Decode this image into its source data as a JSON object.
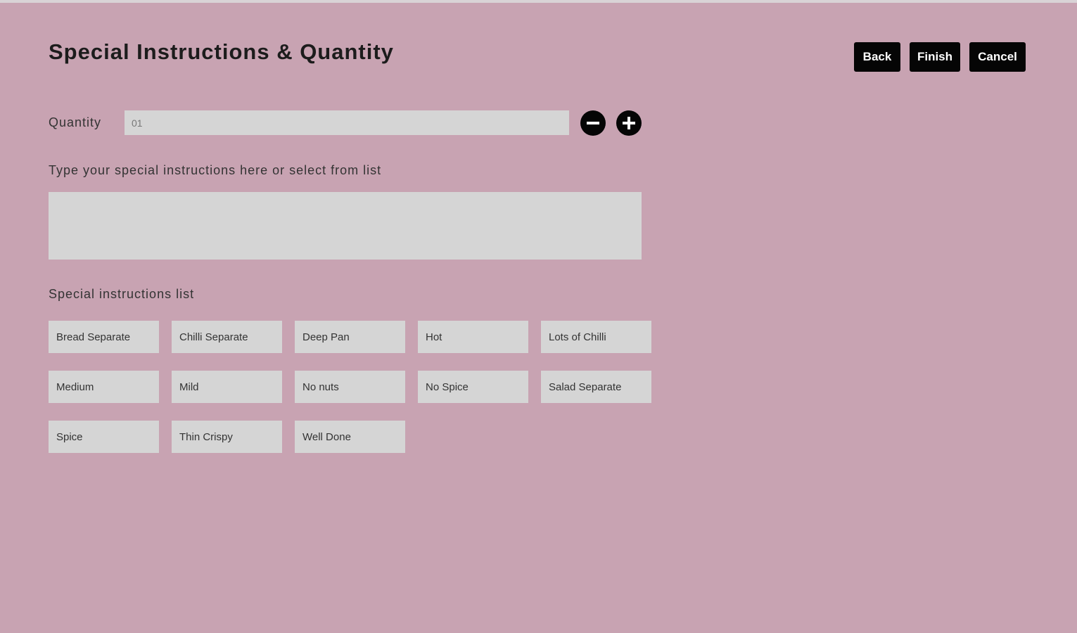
{
  "page": {
    "title": "Special Instructions & Quantity",
    "background_color": "#c8a3b2"
  },
  "actions": {
    "back_label": "Back",
    "finish_label": "Finish",
    "cancel_label": "Cancel"
  },
  "quantity": {
    "label": "Quantity",
    "value": "01",
    "minus_icon": "minus-circle-icon",
    "plus_icon": "plus-circle-icon"
  },
  "instructions": {
    "label": "Type your special instructions here or select from list",
    "value": ""
  },
  "instruction_list": {
    "label": "Special instructions list",
    "items": [
      "Bread Separate",
      "Chilli Separate",
      "Deep Pan",
      "Hot",
      "Lots of Chilli",
      "Medium",
      "Mild",
      "No nuts",
      "No Spice",
      "Salad Separate",
      "Spice",
      "Thin Crispy",
      "Well Done"
    ]
  }
}
